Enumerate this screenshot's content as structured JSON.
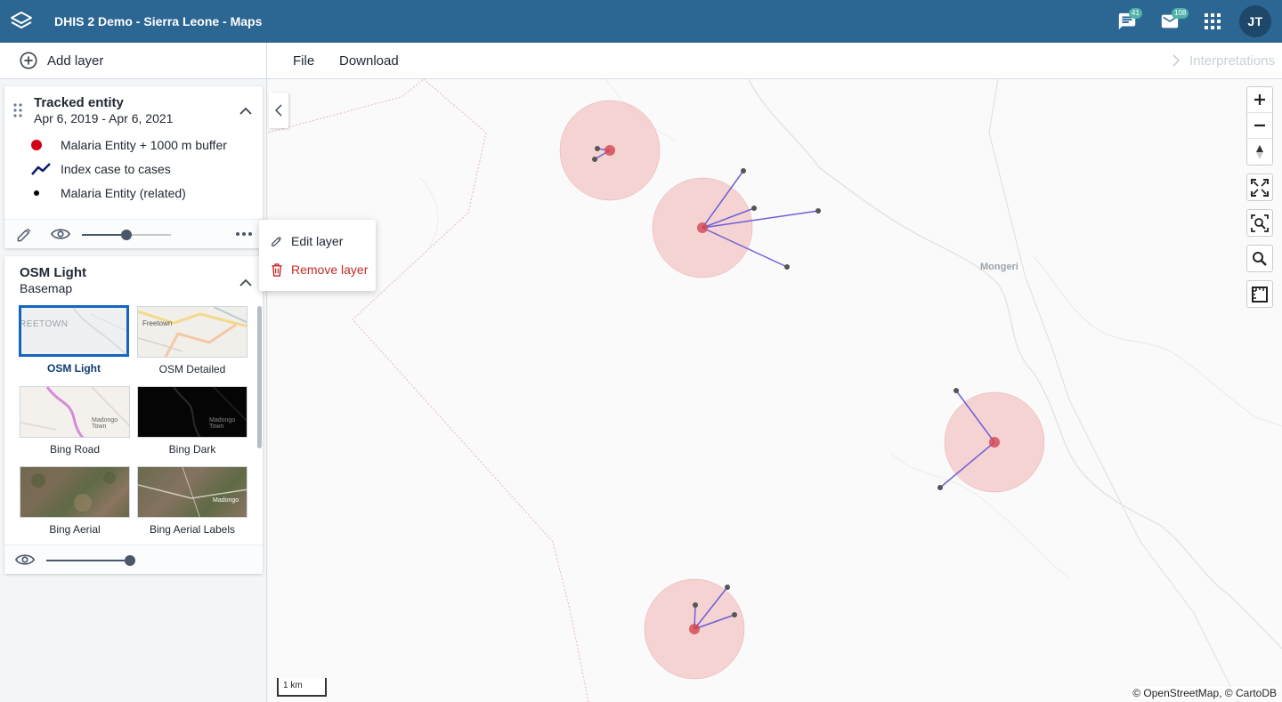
{
  "header": {
    "app_title": "DHIS 2 Demo - Sierra Leone - Maps",
    "messages_count": "41",
    "mail_count": "108",
    "user_initials": "JT",
    "brand_color": "#2c6693"
  },
  "toolbar": {
    "add_layer_label": "Add layer",
    "menu": [
      "File",
      "Download"
    ],
    "interpretations_label": "Interpretations"
  },
  "layers": {
    "tracked_entity": {
      "title": "Tracked entity",
      "period": "Apr 6, 2019 - Apr 6, 2021",
      "legend": [
        {
          "icon": "red-dot-icon",
          "label": "Malaria Entity + 1000 m buffer",
          "color": "#d0021b"
        },
        {
          "icon": "line-icon",
          "label": "Index case to cases",
          "color": "#0d1f6e"
        },
        {
          "icon": "black-dot-icon",
          "label": "Malaria Entity (related)",
          "color": "#000000"
        }
      ],
      "opacity": 0.5
    },
    "basemap": {
      "title": "OSM Light",
      "subtitle": "Basemap",
      "options": [
        {
          "name": "OSM Light",
          "selected": true,
          "thumb_text": "REETOWN"
        },
        {
          "name": "OSM Detailed",
          "selected": false,
          "thumb_text": "Freetown"
        },
        {
          "name": "Bing Road",
          "selected": false,
          "thumb_text": "Madongo Town"
        },
        {
          "name": "Bing Dark",
          "selected": false,
          "thumb_text": "Madongo Town"
        },
        {
          "name": "Bing Aerial",
          "selected": false,
          "thumb_text": ""
        },
        {
          "name": "Bing Aerial Labels",
          "selected": false,
          "thumb_text": "Madongo"
        }
      ],
      "opacity": 1.0
    }
  },
  "context_menu": {
    "edit_label": "Edit layer",
    "remove_label": "Remove layer"
  },
  "map": {
    "place_label": "Mongeri",
    "scale_label": "1 km",
    "attribution": "© OpenStreetMap, © CartoDB",
    "buffer_color": "#f3c6c6",
    "line_color": "#6c5fd6",
    "center_color": "#d4464f"
  }
}
